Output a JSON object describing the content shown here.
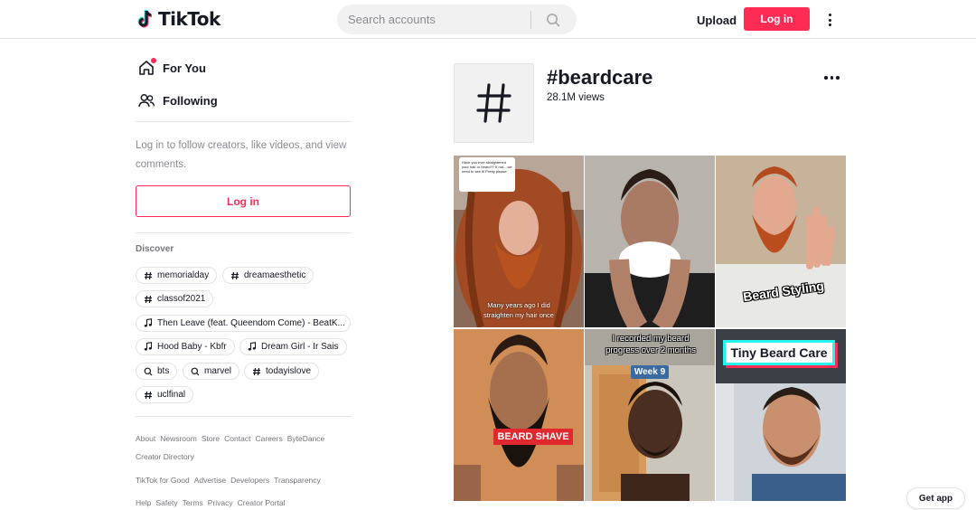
{
  "header": {
    "brand": "TikTok",
    "search_placeholder": "Search accounts",
    "upload_label": "Upload",
    "login_label": "Log in"
  },
  "sidebar": {
    "nav": [
      {
        "label": "For You",
        "icon": "home-icon"
      },
      {
        "label": "Following",
        "icon": "people-icon"
      }
    ],
    "login_prompt": "Log in to follow creators, like videos, and view comments.",
    "login_button": "Log in",
    "discover_title": "Discover",
    "discover_items": [
      {
        "label": "memorialday",
        "icon": "hashtag-icon"
      },
      {
        "label": "dreamaesthetic",
        "icon": "hashtag-icon"
      },
      {
        "label": "classof2021",
        "icon": "hashtag-icon"
      },
      {
        "label": "Then Leave (feat. Queendom Come) - BeatK...",
        "icon": "music-note-icon"
      },
      {
        "label": "Hood Baby - Kbfr",
        "icon": "music-note-icon"
      },
      {
        "label": "Dream Girl - Ir Sais",
        "icon": "music-note-icon"
      },
      {
        "label": "bts",
        "icon": "search-icon"
      },
      {
        "label": "marvel",
        "icon": "search-icon"
      },
      {
        "label": "todayislove",
        "icon": "hashtag-icon"
      },
      {
        "label": "uclfinal",
        "icon": "hashtag-icon"
      }
    ],
    "footer": [
      [
        "About",
        "Newsroom",
        "Store",
        "Contact",
        "Careers",
        "ByteDance"
      ],
      [
        "Creator Directory"
      ],
      [
        "TikTok for Good",
        "Advertise",
        "Developers",
        "Transparency"
      ],
      [
        "Help",
        "Safety",
        "Terms",
        "Privacy",
        "Creator Portal"
      ]
    ]
  },
  "hashtag": {
    "title": "#beardcare",
    "views": "28.1M views"
  },
  "videos": [
    {
      "caption": "Many years ago I did straighten my hair once",
      "sticker": "Have you ever straightened your hair or beard?? If not....we need to see it! Pretty please"
    },
    {
      "caption": ""
    },
    {
      "caption": "Beard Styling"
    },
    {
      "caption": "BEARD SHAVE"
    },
    {
      "caption": "I recorded my beard progress over 2 months",
      "badge": "Week 9"
    },
    {
      "caption": "Tiny Beard Care"
    }
  ],
  "get_app_label": "Get app",
  "colors": {
    "accent": "#fe2c55",
    "text": "#161823",
    "muted": "#8a8b91"
  }
}
